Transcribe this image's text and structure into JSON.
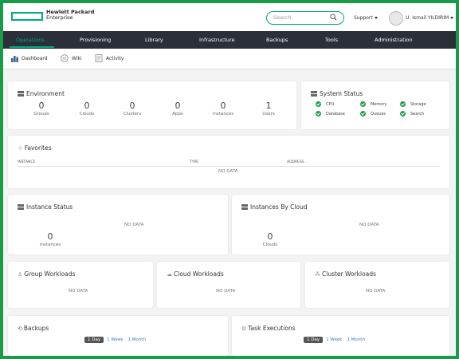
{
  "brand": {
    "line1": "Hewlett Packard",
    "line2": "Enterprise",
    "accent": "#01a982"
  },
  "header": {
    "search_placeholder": "Search",
    "support_label": "Support",
    "user_name": "U. Ismail YILDIRIM"
  },
  "nav": {
    "items": [
      {
        "label": "Operations",
        "active": true
      },
      {
        "label": "Provisioning"
      },
      {
        "label": "Library"
      },
      {
        "label": "Infrastructure"
      },
      {
        "label": "Backups"
      },
      {
        "label": "Tools"
      },
      {
        "label": "Administration"
      }
    ]
  },
  "subnav": {
    "items": [
      {
        "label": "Dashboard",
        "icon": "bar-chart-icon"
      },
      {
        "label": "Wiki",
        "icon": "wiki-icon"
      },
      {
        "label": "Activity",
        "icon": "activity-icon"
      }
    ]
  },
  "environment": {
    "title": "Environment",
    "stats": [
      {
        "value": "0",
        "label": "Groups"
      },
      {
        "value": "0",
        "label": "Clouds"
      },
      {
        "value": "0",
        "label": "Clusters"
      },
      {
        "value": "0",
        "label": "Apps"
      },
      {
        "value": "0",
        "label": "Instances"
      },
      {
        "value": "1",
        "label": "Users"
      }
    ]
  },
  "system_status": {
    "title": "System Status",
    "items": [
      "CPU",
      "Memory",
      "Storage",
      "Database",
      "Queues",
      "Search"
    ],
    "ok_color": "#1c9d4b"
  },
  "favorites": {
    "title": "Favorites",
    "columns": [
      "INSTANCE",
      "TYPE",
      "ADDRESS"
    ],
    "empty": "NO DATA"
  },
  "instance_status": {
    "title": "Instance Status",
    "empty": "NO DATA",
    "value": "0",
    "label": "Instances"
  },
  "instances_by_cloud": {
    "title": "Instances By Cloud",
    "empty": "NO DATA",
    "value": "0",
    "label": "Clouds"
  },
  "group_workloads": {
    "title": "Group Workloads",
    "empty": "NO DATA"
  },
  "cloud_workloads": {
    "title": "Cloud Workloads",
    "empty": "NO DATA"
  },
  "cluster_workloads": {
    "title": "Cluster Workloads",
    "empty": "NO DATA"
  },
  "backups": {
    "title": "Backups",
    "ranges": [
      "1 Day",
      "1 Week",
      "1 Month"
    ]
  },
  "task_executions": {
    "title": "Task Executions",
    "ranges": [
      "1 Day",
      "1 Week",
      "1 Month"
    ]
  }
}
